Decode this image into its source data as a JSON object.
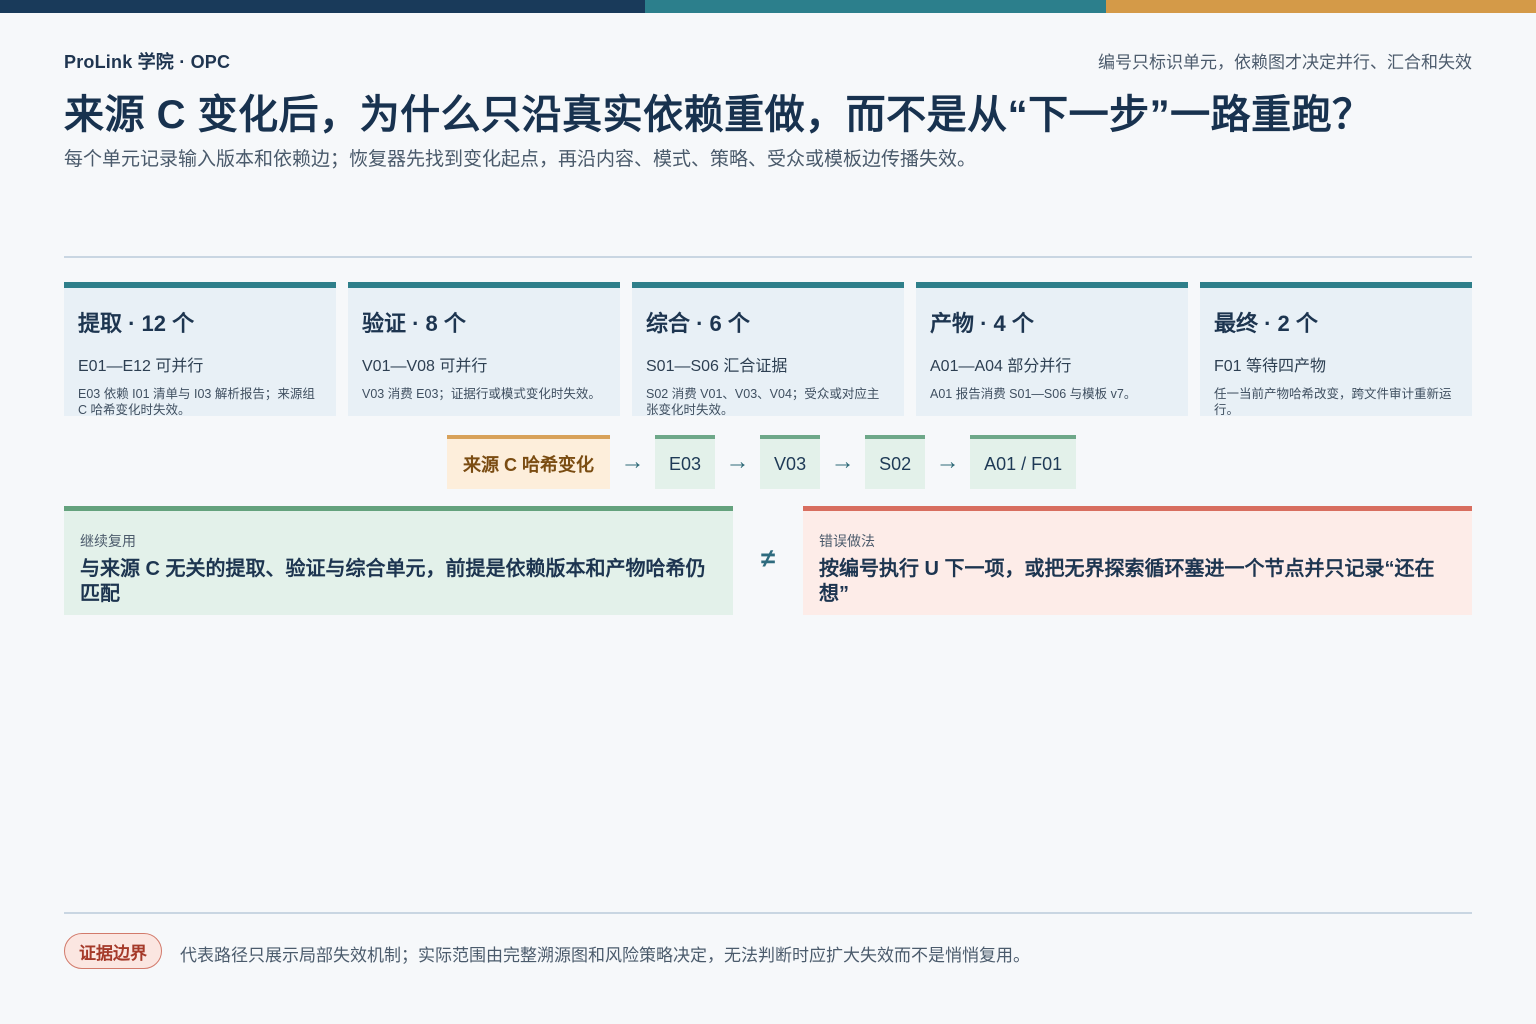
{
  "header": {
    "brand": "ProLink 学院 · OPC",
    "tagline": "编号只标识单元，依赖图才决定并行、汇合和失效",
    "title": "来源 C 变化后，为什么只沿真实依赖重做，而不是从“下一步”一路重跑？",
    "subtitle": "每个单元记录输入版本和依赖边；恢复器先找到变化起点，再沿内容、模式、策略、受众或模板边传播失效。"
  },
  "colors": {
    "bar_navy": "#193a5a",
    "bar_teal": "#2c7f8c",
    "bar_gold": "#d49a48"
  },
  "stages": [
    {
      "title": "提取 · 12 个",
      "range": "E01—E12 可并行",
      "note": "E03 依赖 I01 清单与 I03 解析报告；来源组 C 哈希变化时失效。"
    },
    {
      "title": "验证 · 8 个",
      "range": "V01—V08 可并行",
      "note": "V03 消费 E03；证据行或模式变化时失效。"
    },
    {
      "title": "综合 · 6 个",
      "range": "S01—S06 汇合证据",
      "note": "S02 消费 V01、V03、V04；受众或对应主张变化时失效。"
    },
    {
      "title": "产物 · 4 个",
      "range": "A01—A04 部分并行",
      "note": "A01 报告消费 S01—S06 与模板 v7。"
    },
    {
      "title": "最终 · 2 个",
      "range": "F01 等待四产物",
      "note": "任一当前产物哈希改变，跨文件审计重新运行。"
    }
  ],
  "flow": {
    "source": "来源 C 哈希变化",
    "arrow": "→",
    "steps": [
      "E03",
      "V03",
      "S02",
      "A01 / F01"
    ]
  },
  "keep": {
    "label": "继续复用",
    "text": "与来源 C 无关的提取、验证与综合单元，前提是依赖版本和产物哈希仍匹配"
  },
  "neq": "≠",
  "wrong": {
    "label": "错误做法",
    "text": "按编号执行 U 下一项，或把无界探索循环塞进一个节点并只记录“还在想”"
  },
  "footer": {
    "badge": "证据边界",
    "note": "代表路径只展示局部失效机制；实际范围由完整溯源图和风险策略决定，无法判断时应扩大失效而不是悄悄复用。"
  }
}
